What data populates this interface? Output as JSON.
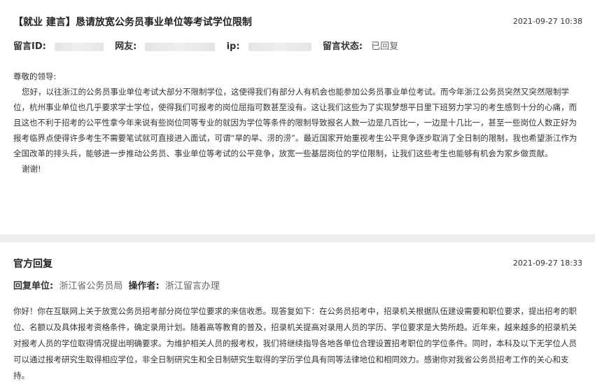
{
  "post": {
    "title": "【就业 建言】恳请放宽公务员事业单位等考试学位限制",
    "time": "2021-09-27 10:38",
    "meta": {
      "id_label": "留言ID:",
      "user_label": "网友:",
      "ip_label": "ip:",
      "status_label": "留言状态:",
      "status_value": "已回复"
    },
    "greeting": "尊敬的领导:",
    "content": "您好，以往浙江的公务员事业单位考试大部分不限制学位，这使得我们有部分人有机会也能参加公务员事业单位考试。而今年浙江公务员突然又突然限制学位，杭州事业单位也几乎要求学士学位，使得我们可报考的岗位屈指可数甚至没有。这让我们这些为了实现梦想平日里下班努力学习的考生感到十分的心痛，而且这也不利于招考的公平性拿今年来说有些岗位同等专业的就因为学位等条件的限制导致报名人数一边是几百比一，一边是十几比一，甚至一些岗位人数正好为报考临界点使得许多考生不需要笔试就可直接进入面试，可谓“旱的旱、涝的涝”。最近国家开始重视考生公平竞争逐步取消了全日制的限制，我也希望浙江作为全国改革的排头兵，能够进一步推动公务员、事业单位等考试的公平竞争，放宽一些基层岗位的学位限制，让我们这些考生也能够有机会为家乡做贡献。",
    "closing": "谢谢!"
  },
  "reply": {
    "title": "官方回复",
    "time": "2021-09-27 18:33",
    "unit_label": "回复单位:",
    "unit_value": "浙江省公务员局",
    "operator_label": "操作者:",
    "operator_value": "浙江留言办理",
    "content": "你好！你在互联网上关于放宽公务员招考部分岗位学位要求的来信收悉。现答复如下：在公务员招考中，招录机关根据队伍建设需要和职位要求，提出招考的职位、名额以及具体报考资格条件，确定录用计划。随着高等教育的普及，招录机关提高对录用人员的学历、学位要求是大势所趋。近年来，越来越多的招录机关对报考人员的学位取得情况提出明确要求。为维护相关人员的报考权，我们将继续指导各地各单位合理设置招考职位的学位条件。同时，本科及以下无学位人员可以通过报考研究生取得相应学位，非全日制研究生和全日制研究生取得的学历学位具有同等法律地位和相同效力。感谢你对我省公务员招考工作的关心和支持。"
  }
}
